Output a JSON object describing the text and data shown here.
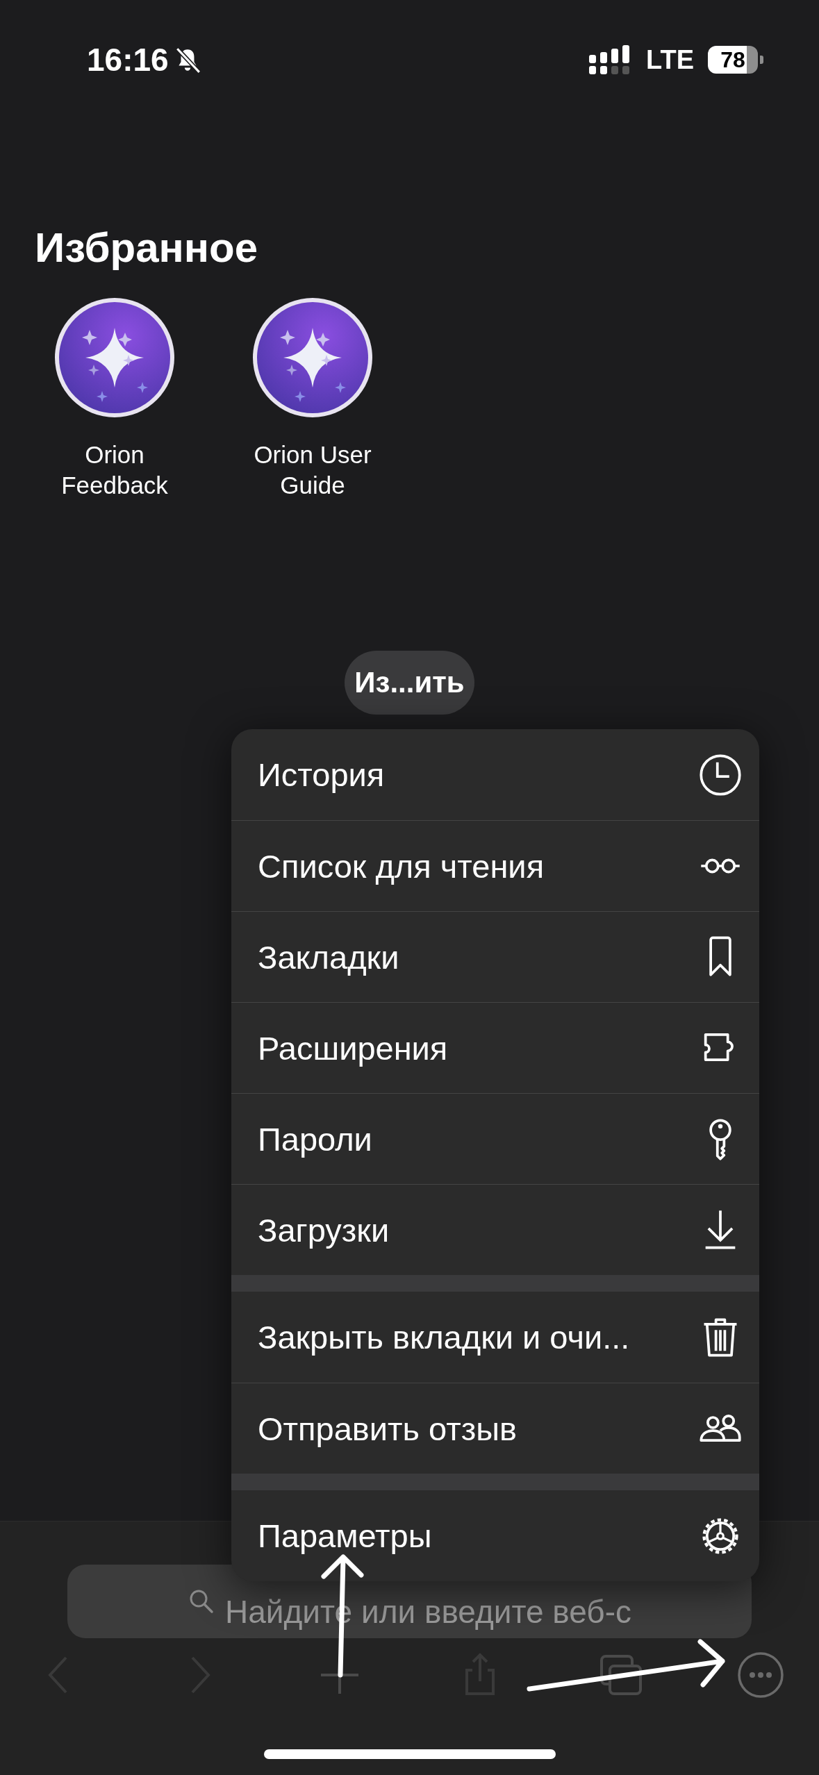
{
  "status_bar": {
    "time": "16:16",
    "network": "LTE",
    "battery": "78"
  },
  "favorites": {
    "title": "Избранное",
    "items": [
      {
        "label": "Orion Feedback"
      },
      {
        "label": "Orion User Guide"
      }
    ]
  },
  "edit_button": "Из...ить",
  "menu": {
    "sections": [
      {
        "items": [
          {
            "label": "История",
            "kind": "history"
          },
          {
            "label": "Список для чтения",
            "kind": "reading-list"
          },
          {
            "label": "Закладки",
            "kind": "bookmarks"
          },
          {
            "label": "Расширения",
            "kind": "extensions"
          },
          {
            "label": "Пароли",
            "kind": "passwords"
          },
          {
            "label": "Загрузки",
            "kind": "downloads"
          }
        ]
      },
      {
        "items": [
          {
            "label": "Закрыть вкладки и очи...",
            "kind": "close-tabs"
          },
          {
            "label": "Отправить отзыв",
            "kind": "feedback"
          }
        ]
      },
      {
        "items": [
          {
            "label": "Параметры",
            "kind": "settings"
          }
        ]
      }
    ]
  },
  "search": {
    "placeholder": "Найдите или введите веб-с"
  }
}
